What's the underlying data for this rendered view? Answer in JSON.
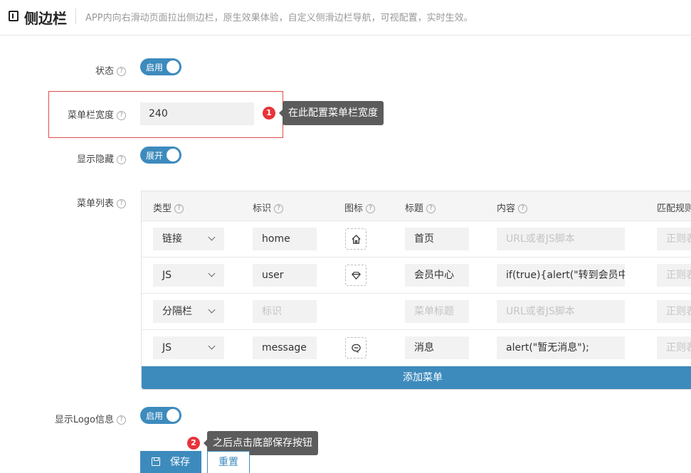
{
  "header": {
    "title": "侧边栏",
    "description": "APP内向右滑动页面拉出侧边栏，原生效果体验，自定义侧滑边栏导航，可视配置，实时生效。"
  },
  "help_glyph": "?",
  "form": {
    "status": {
      "label": "状态",
      "toggle_text": "启用",
      "on": true
    },
    "menu_width": {
      "label": "菜单栏宽度",
      "value": "240"
    },
    "show_hide": {
      "label": "显示隐藏",
      "toggle_text": "展开",
      "on": true
    },
    "menu_list": {
      "label": "菜单列表"
    },
    "show_logo": {
      "label": "显示Logo信息",
      "toggle_text": "启用",
      "on": true
    }
  },
  "annotations": [
    {
      "number": "1",
      "text": "在此配置菜单栏宽度"
    },
    {
      "number": "2",
      "text": "之后点击底部保存按钮"
    }
  ],
  "table": {
    "headers": [
      "类型",
      "标识",
      "图标",
      "标题",
      "内容",
      "匹配规则"
    ],
    "rows": [
      {
        "type": "链接",
        "id": "home",
        "icon": "home-icon",
        "title": "首页",
        "content": "URL或者JS脚本",
        "content_placeholder": true,
        "rule": "正则表达式"
      },
      {
        "type": "JS",
        "id": "user",
        "icon": "diamond-icon",
        "title": "会员中心",
        "content": "if(true){alert(\"转到会员中心\")}",
        "content_placeholder": false,
        "rule": "正则表达式"
      },
      {
        "type": "分隔栏",
        "id": "标识",
        "icon": "",
        "title": "菜单标题",
        "content": "URL或者JS脚本",
        "content_placeholder": true,
        "rule": "正则表达式",
        "all_placeholder": true
      },
      {
        "type": "JS",
        "id": "message",
        "icon": "chat-icon",
        "title": "消息",
        "content": "alert(\"暂无消息\");",
        "content_placeholder": false,
        "rule": "正则表达式"
      }
    ],
    "add_label": "添加菜单"
  },
  "buttons": {
    "save": "保存",
    "reset": "重置"
  },
  "colors": {
    "primary": "#3d8bbd",
    "badge": "#e8333a",
    "highlight_border": "#e14b4b",
    "tooltip_bg": "#5c5c5c"
  }
}
